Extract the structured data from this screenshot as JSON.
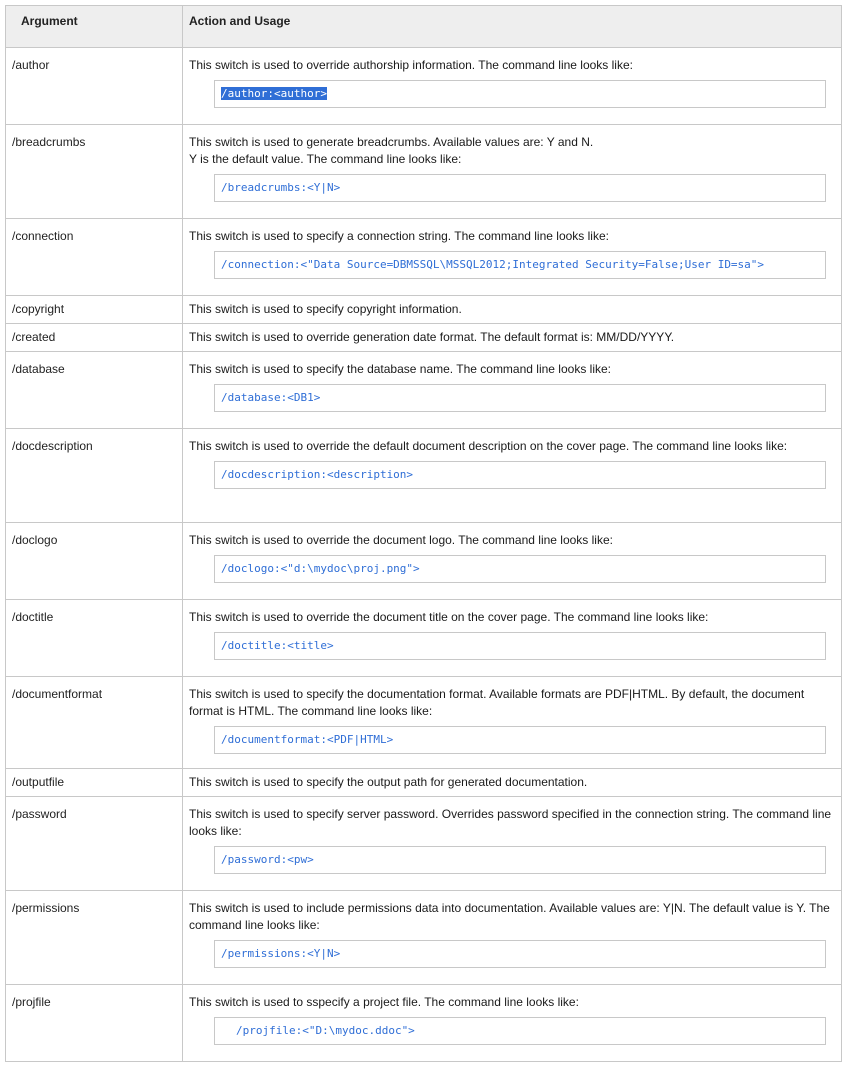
{
  "header": {
    "argument": "Argument",
    "action": "Action and Usage"
  },
  "rows": [
    {
      "arg": "/author",
      "desc": "This switch is used to override authorship information. The command line looks like:",
      "code": "/author:<author>"
    },
    {
      "arg": "/breadcrumbs",
      "desc": "This switch is used to generate breadcrumbs. Available values are: Y and N.\nY is the default value. The command line looks like:",
      "code": "/breadcrumbs:<Y|N>"
    },
    {
      "arg": "/connection",
      "desc": "This switch is used to specify a connection string. The command line looks like:",
      "code": "/connection:<\"Data Source=DBMSSQL\\MSSQL2012;Integrated Security=False;User ID=sa\">"
    },
    {
      "arg": "/copyright",
      "desc": "This switch is used to specify copyright information."
    },
    {
      "arg": "/created",
      "desc": "This switch is used to override generation date format. The default format is: MM/DD/YYYY."
    },
    {
      "arg": "/database",
      "desc": "This switch is used to specify the database name. The command line looks like:",
      "code": "/database:<DB1>"
    },
    {
      "arg": "/docdescription",
      "desc": "This switch is used to override the default document description on the cover page. The command line looks like:",
      "code": "/docdescription:<description>"
    },
    {
      "arg": "/doclogo",
      "desc": "This switch is used to override the document logo. The command line looks like:",
      "code": "/doclogo:<\"d:\\mydoc\\proj.png\">"
    },
    {
      "arg": "/doctitle",
      "desc": "This switch is used to override the document title on the cover page. The command line looks like:",
      "code": "/doctitle:<title>"
    },
    {
      "arg": "/documentformat",
      "desc": "This switch is used to specify the documentation format. Available formats are PDF|HTML. By default, the document format is HTML. The command line looks like:",
      "code": "/documentformat:<PDF|HTML>"
    },
    {
      "arg": "/outputfile",
      "desc": "This switch is used to specify the output path for generated documentation."
    },
    {
      "arg": "/password",
      "desc": "This switch is used to specify server password. Overrides password specified in the connection string. The command line looks like:",
      "code": "/password:<pw>"
    },
    {
      "arg": "/permissions",
      "desc": "This switch is used to include permissions data into documentation. Available values are: Y|N. The default value is Y. The command line looks like:",
      "code": "/permissions:<Y|N>"
    },
    {
      "arg": "/projfile",
      "desc": "This switch is used to sspecify a  project file. The command line looks like:",
      "code": "/projfile:<\"D:\\mydoc.ddoc\">"
    }
  ]
}
